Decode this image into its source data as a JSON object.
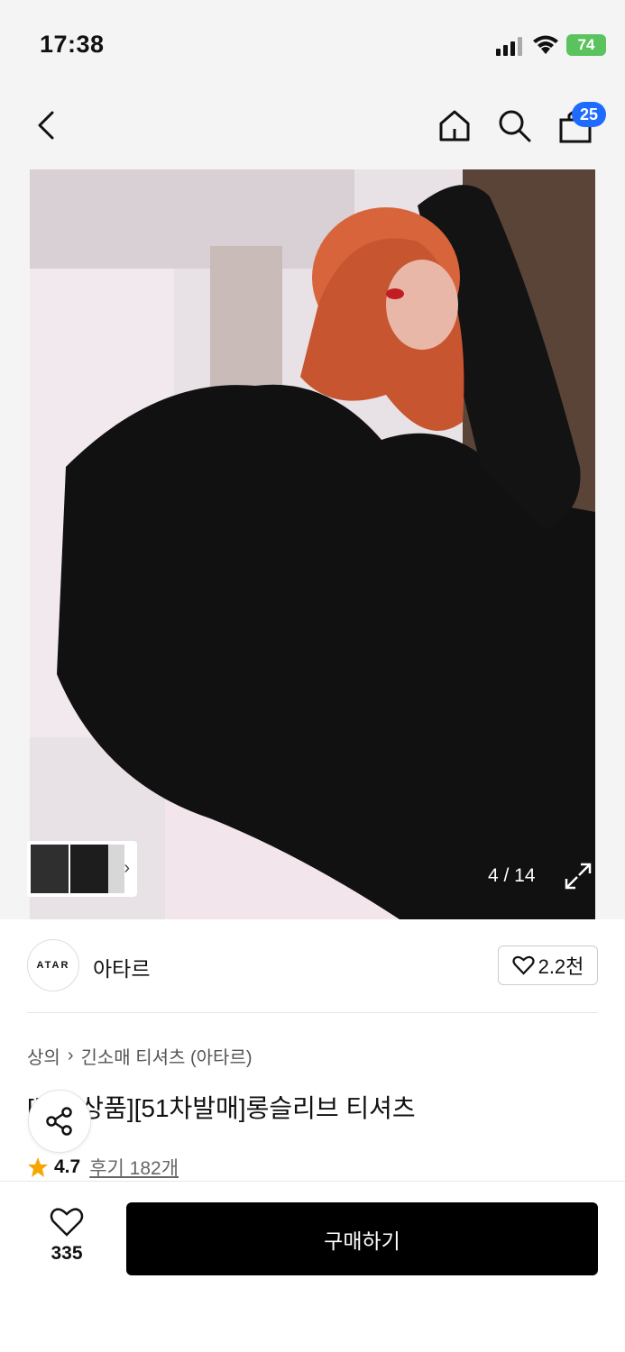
{
  "status": {
    "time": "17:38",
    "battery": "74"
  },
  "nav": {
    "cart_count": "25"
  },
  "gallery": {
    "counter": "4 / 14"
  },
  "brand": {
    "logo_text": "ATAR",
    "name": "아타르",
    "likes": "2.2천"
  },
  "breadcrumb": {
    "category": "상의",
    "subcategory": "긴소매 티셔츠 (아타르)"
  },
  "product": {
    "title": "[단독상품][51차발매]롱슬리브 티셔츠"
  },
  "rating": {
    "score": "4.7",
    "reviews": "후기 182개"
  },
  "bottom": {
    "wish_count": "335",
    "buy_label": "구매하기"
  },
  "colors": {
    "accent": "#1f6bff",
    "battery": "#5ac35e",
    "star": "#f7a600"
  }
}
